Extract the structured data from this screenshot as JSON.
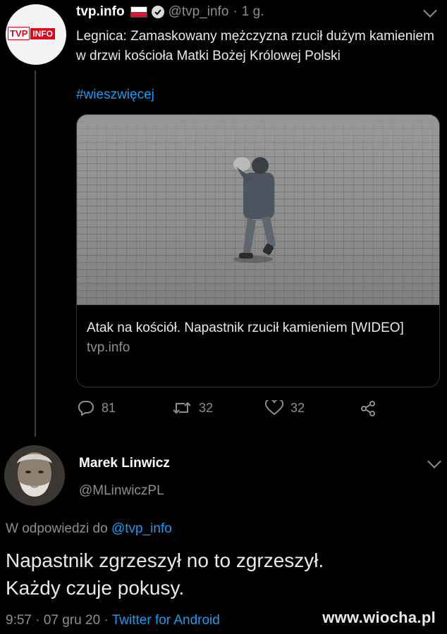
{
  "tweet1": {
    "avatar_logo": {
      "part1": "TVP",
      "part2": "INFO"
    },
    "name": "tvp.info",
    "handle": "@tvp_info",
    "separator": "·",
    "time": "1 g.",
    "text": "Legnica: Zamaskowany mężczyzna rzucił dużym kamieniem w drzwi kościoła Matki Bożej Królowej Polski",
    "hashtag": "#wieszwięcej",
    "card": {
      "title": "Atak na kościół. Napastnik rzucił kamieniem [WIDEO]",
      "domain": "tvp.info"
    },
    "actions": {
      "replies": "81",
      "retweets": "32",
      "likes": "32"
    }
  },
  "tweet2": {
    "name": "Marek Linwicz",
    "handle": "@MLinwiczPL",
    "reply_prefix": "W odpowiedzi do",
    "reply_handle": "@tvp_info",
    "text_line1": "Napastnik zgrzeszył no to zgrzeszył.",
    "text_line2": "Każdy czuje pokusy.",
    "time": "9:57",
    "date": "07 gru 20",
    "dot": "·",
    "source": "Twitter for Android"
  },
  "watermark": "www.wiocha.pl",
  "colors": {
    "background": "#000000",
    "link": "#1d9bf0",
    "muted": "#8b8f94",
    "flag_red": "#dc143c"
  }
}
